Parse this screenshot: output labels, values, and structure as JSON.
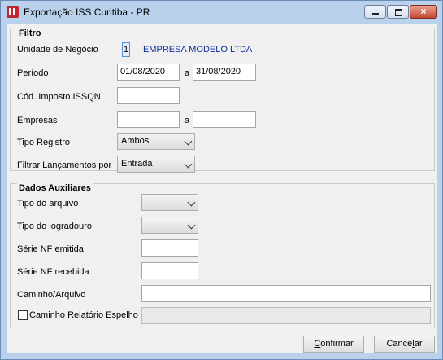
{
  "window": {
    "title": "Exportação ISS Curitiba - PR",
    "close_glyph": "×"
  },
  "filtro": {
    "title": "Filtro",
    "unidade_label": "Unidade de Negócio",
    "unidade_code": "1",
    "unidade_name": "EMPRESA MODELO LTDA",
    "periodo_label": "Período",
    "periodo_from": "01/08/2020",
    "periodo_sep": "a",
    "periodo_to": "31/08/2020",
    "cod_imposto_label": "Cód. Imposto ISSQN",
    "cod_imposto_value": "",
    "empresas_label": "Empresas",
    "empresas_from": "",
    "empresas_sep": "a",
    "empresas_to": "",
    "tipo_registro_label": "Tipo Registro",
    "tipo_registro_value": "Ambos",
    "filtrar_label": "Filtrar Lançamentos por",
    "filtrar_value": "Entrada"
  },
  "auxiliares": {
    "title": "Dados Auxiliares",
    "tipo_arquivo_label": "Tipo do arquivo",
    "tipo_arquivo_value": "",
    "tipo_logradouro_label": "Tipo do logradouro",
    "tipo_logradouro_value": "",
    "serie_emitida_label": "Série NF emitida",
    "serie_emitida_value": "",
    "serie_recebida_label": "Série NF recebida",
    "serie_recebida_value": "",
    "caminho_label": "Caminho/Arquivo",
    "caminho_value": "",
    "espelho_label": "Caminho Relatório Espelho",
    "espelho_checked": false,
    "espelho_value": ""
  },
  "buttons": {
    "confirmar_underline": "C",
    "confirmar_rest": "onfirmar",
    "cancelar_prefix": "Cance",
    "cancelar_underline": "l",
    "cancelar_rest": "ar"
  },
  "colors": {
    "frame": "#b9d1ea",
    "company_text": "#0a2a9a",
    "close_button": "#c74a32"
  }
}
